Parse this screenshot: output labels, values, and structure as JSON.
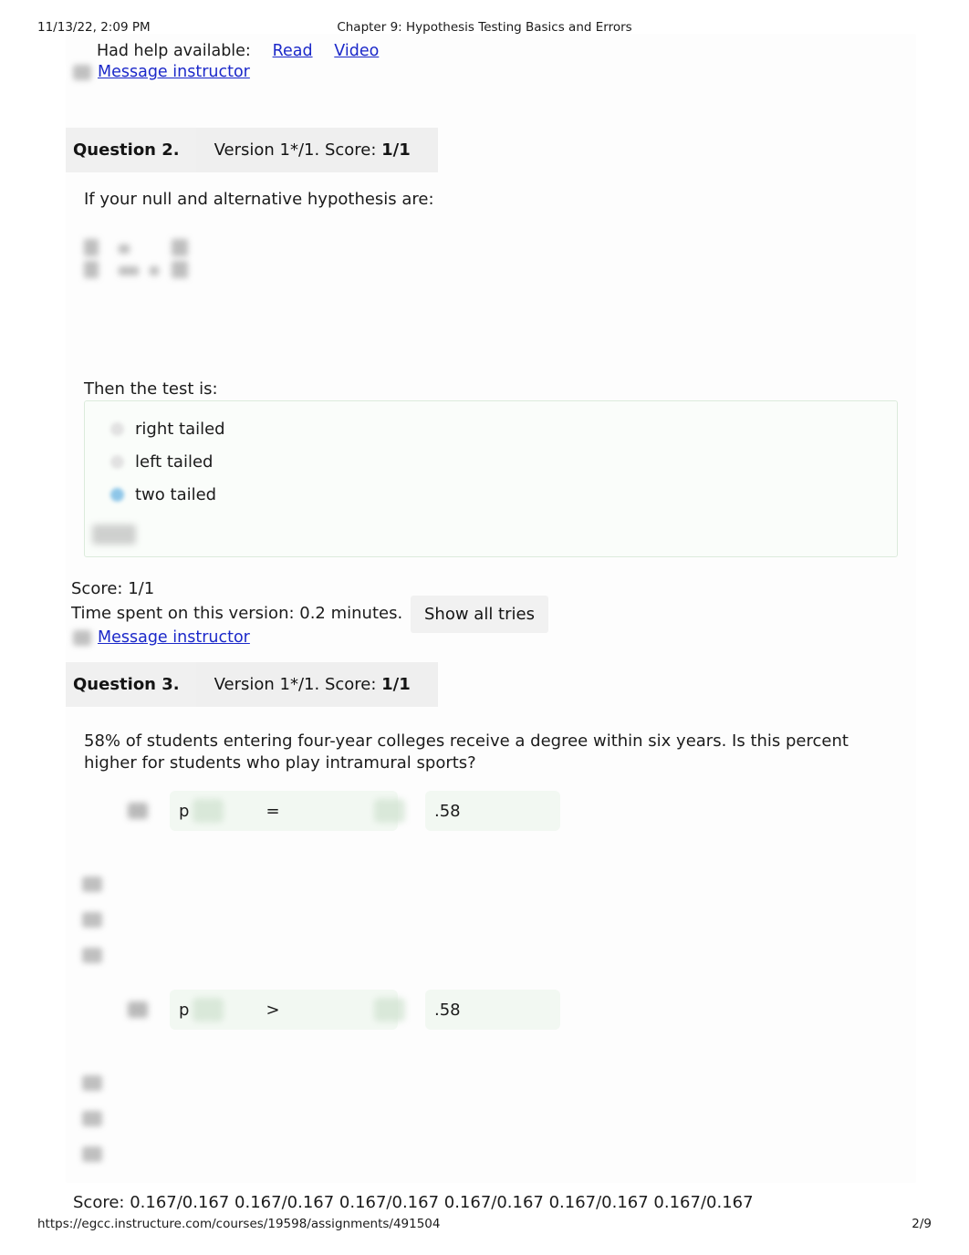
{
  "print": {
    "date": "11/13/22, 2:09 PM",
    "title": "Chapter 9: Hypothesis Testing Basics and Errors",
    "url": "https://egcc.instructure.com/courses/19598/assignments/491504",
    "page": "2/9"
  },
  "help": {
    "label": "Had help available:",
    "read_link": "Read",
    "video_link": "Video",
    "message_instructor": "Message instructor"
  },
  "question2": {
    "number": "Question 2.",
    "version": "Version 1*/1. Score: ",
    "version_score": "1/1",
    "prompt": "If your null and alternative hypothesis are:",
    "then_label": "Then the test is:",
    "options": [
      {
        "label": "right tailed",
        "selected": false
      },
      {
        "label": "left tailed",
        "selected": false
      },
      {
        "label": "two tailed",
        "selected": true
      }
    ],
    "score": "Score: 1/1",
    "time_spent": "Time spent on this version: 0.2 minutes.",
    "show_all_tries": "Show all tries",
    "message_instructor": "Message instructor"
  },
  "question3": {
    "number": "Question 3.",
    "version": "Version 1*/1. Score: ",
    "version_score": "1/1",
    "prompt": "58% of students entering four-year colleges receive a degree within six years. Is this percent higher for students who play intramural sports?",
    "rows": [
      {
        "param": "p",
        "operator": "=",
        "value": ".58"
      },
      {
        "param": "p",
        "operator": ">",
        "value": ".58"
      }
    ],
    "score": "Score: 0.167/0.167 0.167/0.167 0.167/0.167 0.167/0.167 0.167/0.167 0.167/0.167"
  },
  "colors": {
    "link": "#1b28c9",
    "panel_border": "#dcebdc",
    "panel_bg": "#fafdfa",
    "selected_radio": "#8ec6e8",
    "header_bar": "#f0f0f0"
  }
}
